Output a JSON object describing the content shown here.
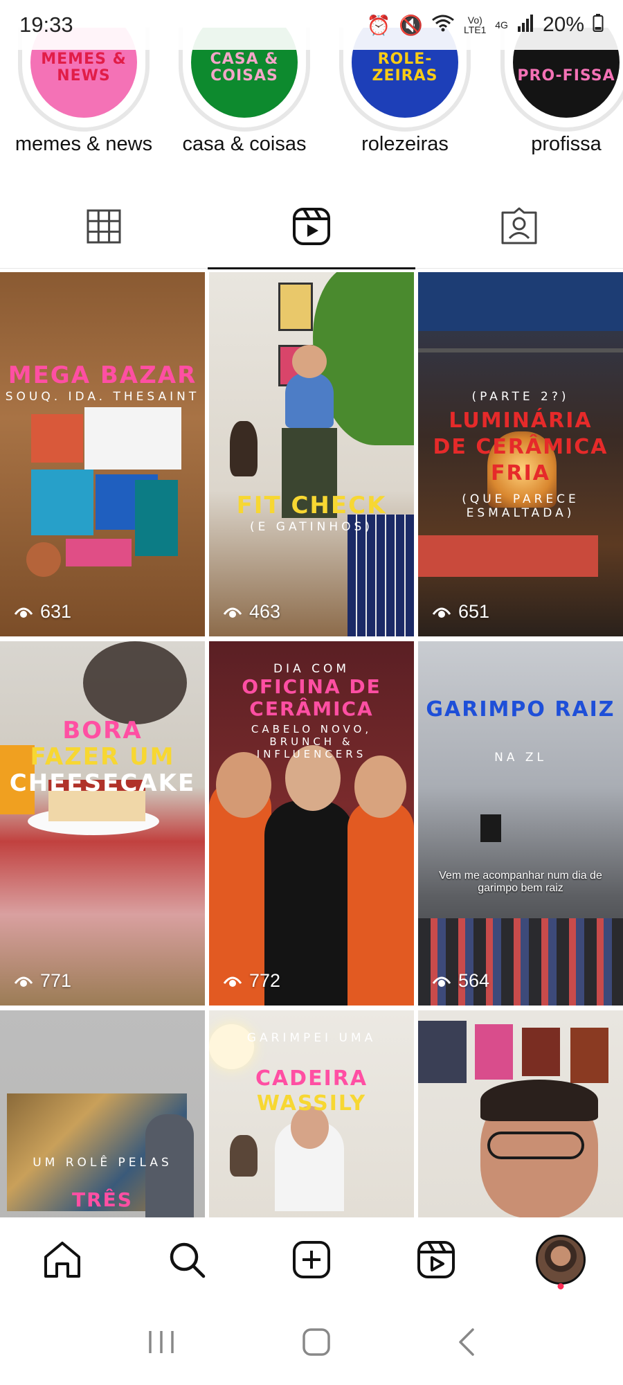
{
  "status_bar": {
    "time": "19:33",
    "network_lte": "Vo) LTE1",
    "network_4g": "4G",
    "battery": "20%"
  },
  "highlights": [
    {
      "circle_text": "MEMES & NEWS",
      "label": "memes & news",
      "bg": "#f472b6",
      "fg": "#e11d48"
    },
    {
      "circle_text": "CASA & COISAS",
      "label": "casa & coisas",
      "bg": "#0d8a2e",
      "fg": "#f4a6c8"
    },
    {
      "circle_text": "ROLE-ZEIRAS",
      "label": "rolezeiras",
      "bg": "#1d3fb8",
      "fg": "#facc15"
    },
    {
      "circle_text": "PRO-FISSA",
      "label": "profissa",
      "bg": "#141414",
      "fg": "#f472b6"
    }
  ],
  "tabs": [
    {
      "name": "grid",
      "icon": "grid-icon",
      "active": false
    },
    {
      "name": "reels",
      "icon": "reels-icon",
      "active": true
    },
    {
      "name": "tagged",
      "icon": "tagged-icon",
      "active": false
    }
  ],
  "reels": [
    {
      "views": "631",
      "line1": "MEGA BAZAR",
      "line2": "SOUQ. IDA. THESAINT"
    },
    {
      "views": "463",
      "line1": "FIT CHECK",
      "line2": "(E GATINHOS)"
    },
    {
      "views": "651",
      "line0": "(PARTE 2?)",
      "line1": "LUMINÁRIA DE CERÂMICA FRIA",
      "line2": "(QUE PARECE ESMALTADA)"
    },
    {
      "views": "771",
      "line1": "BORA",
      "line2": "FAZER UM",
      "line3": "CHEESECAKE"
    },
    {
      "views": "772",
      "line0": "DIA COM",
      "line1": "OFICINA DE CERÂMICA",
      "line2": "CABELO NOVO, BRUNCH & INFLUENCERS"
    },
    {
      "views": "564",
      "line1": "GARIMPO RAIZ",
      "line2": "NA ZL",
      "caption": "Vem me acompanhar num dia de garimpo bem raiz"
    },
    {
      "line1": "UM ROLÊ PELAS",
      "line2": "TRÊS PINACOTECAS"
    },
    {
      "line1": "GARIMPEI UMA",
      "line2": "CADEIRA",
      "line3": "WASSILY"
    },
    {
      "line1": ""
    }
  ],
  "bottom_nav": [
    "home-icon",
    "search-icon",
    "create-icon",
    "reels-icon",
    "profile-avatar"
  ],
  "colors": {
    "accent_pink": "#ff4fa3",
    "accent_yellow": "#f7d732",
    "accent_red": "#e62a2a",
    "accent_blue": "#1e4fd8"
  }
}
